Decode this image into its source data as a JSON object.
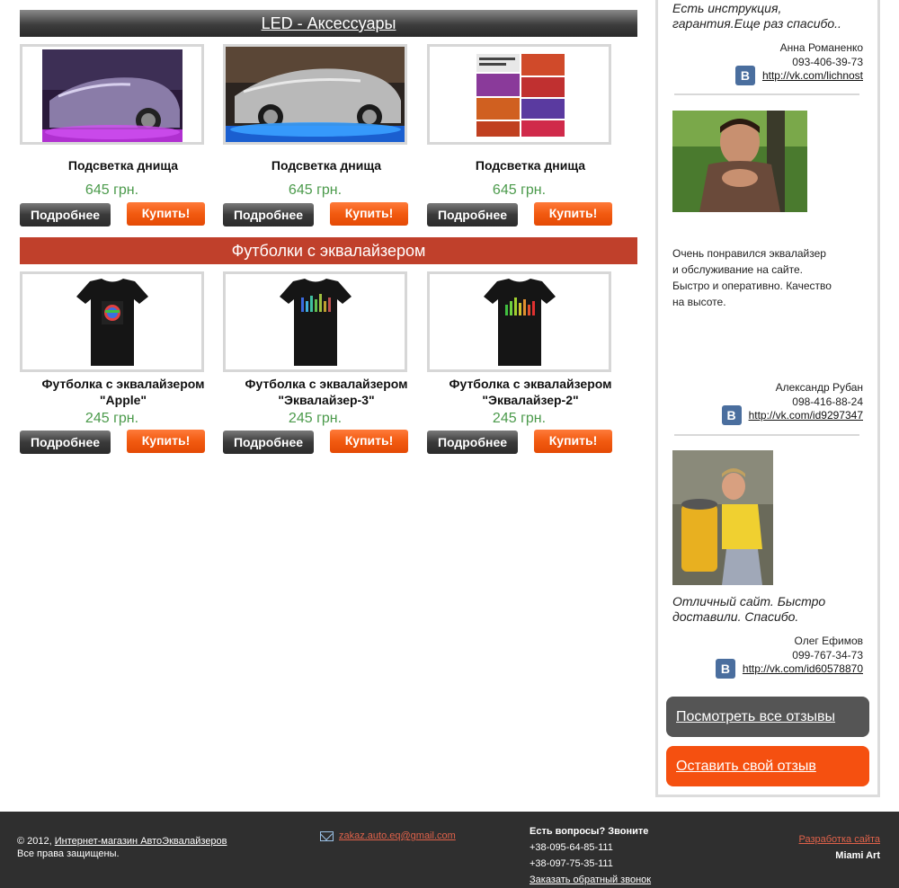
{
  "sections": {
    "led_title": "LED - Аксессуары",
    "tshirts_title": "Футболки с эквалайзером"
  },
  "led_products": [
    {
      "name": "Подсветка днища",
      "price": "645 грн.",
      "more": "Подробнее",
      "buy": "Купить!"
    },
    {
      "name": "Подсветка днища",
      "price": "645 грн.",
      "more": "Подробнее",
      "buy": "Купить!"
    },
    {
      "name": "Подсветка днища",
      "price": "645 грн.",
      "more": "Подробнее",
      "buy": "Купить!"
    }
  ],
  "tshirt_products": [
    {
      "name_line1": "Футболка с эквалайзером",
      "name_line2": "\"Apple\"",
      "price": "245 грн.",
      "more": "Подробнее",
      "buy": "Купить!"
    },
    {
      "name_line1": "Футболка с эквалайзером",
      "name_line2": "\"Эквалайзер-3\"",
      "price": "245 грн.",
      "more": "Подробнее",
      "buy": "Купить!"
    },
    {
      "name_line1": "Футболка с эквалайзером",
      "name_line2": "\"Эквалайзер-2\"",
      "price": "245 грн.",
      "more": "Подробнее",
      "buy": "Купить!"
    }
  ],
  "sidebar": {
    "review1": {
      "text_line1": "Есть инструкция,",
      "text_line2": "гарантия.Еще раз спасибо..",
      "author": "Анна Романенко",
      "phone": "093-406-39-73",
      "link": "http://vk.com/lichnost"
    },
    "review2": {
      "text_lines": [
        "Очень понравился эквалайзер",
        "и обслуживание на сайте.",
        "Быстро и оперативно. Качество",
        "на высоте."
      ],
      "author": "Александр Рубан",
      "phone": "098-416-88-24",
      "link": "http://vk.com/id9297347"
    },
    "review3": {
      "text_line1": "Отличный сайт. Быстро",
      "text_line2": "доставили. Спасибо.",
      "author": "Олег Ефимов",
      "phone": "099-767-34-73",
      "link": "http://vk.com/id60578870"
    },
    "vk_letter": "B",
    "all_reviews": "Посмотреть все отзывы",
    "leave_review": "Оставить свой отзыв"
  },
  "footer": {
    "copyright_prefix": "© 2012,",
    "shop_link": "Интернет-магазин АвтоЭквалайзеров",
    "rights": "Все права защищены.",
    "email": "zakaz.auto.eq@gmail.com",
    "questions": "Есть вопросы? Звоните",
    "phone1": "+38-095-64-85-111",
    "phone2": "+38-097-75-35-111",
    "callback": "Заказать обратный звонок",
    "dev_link": "Разработка сайта",
    "dev_name": "Miami Art"
  },
  "colors": {
    "accent_orange": "#f25a10",
    "price_green": "#4b9a4b",
    "header_red": "#c0402b"
  }
}
